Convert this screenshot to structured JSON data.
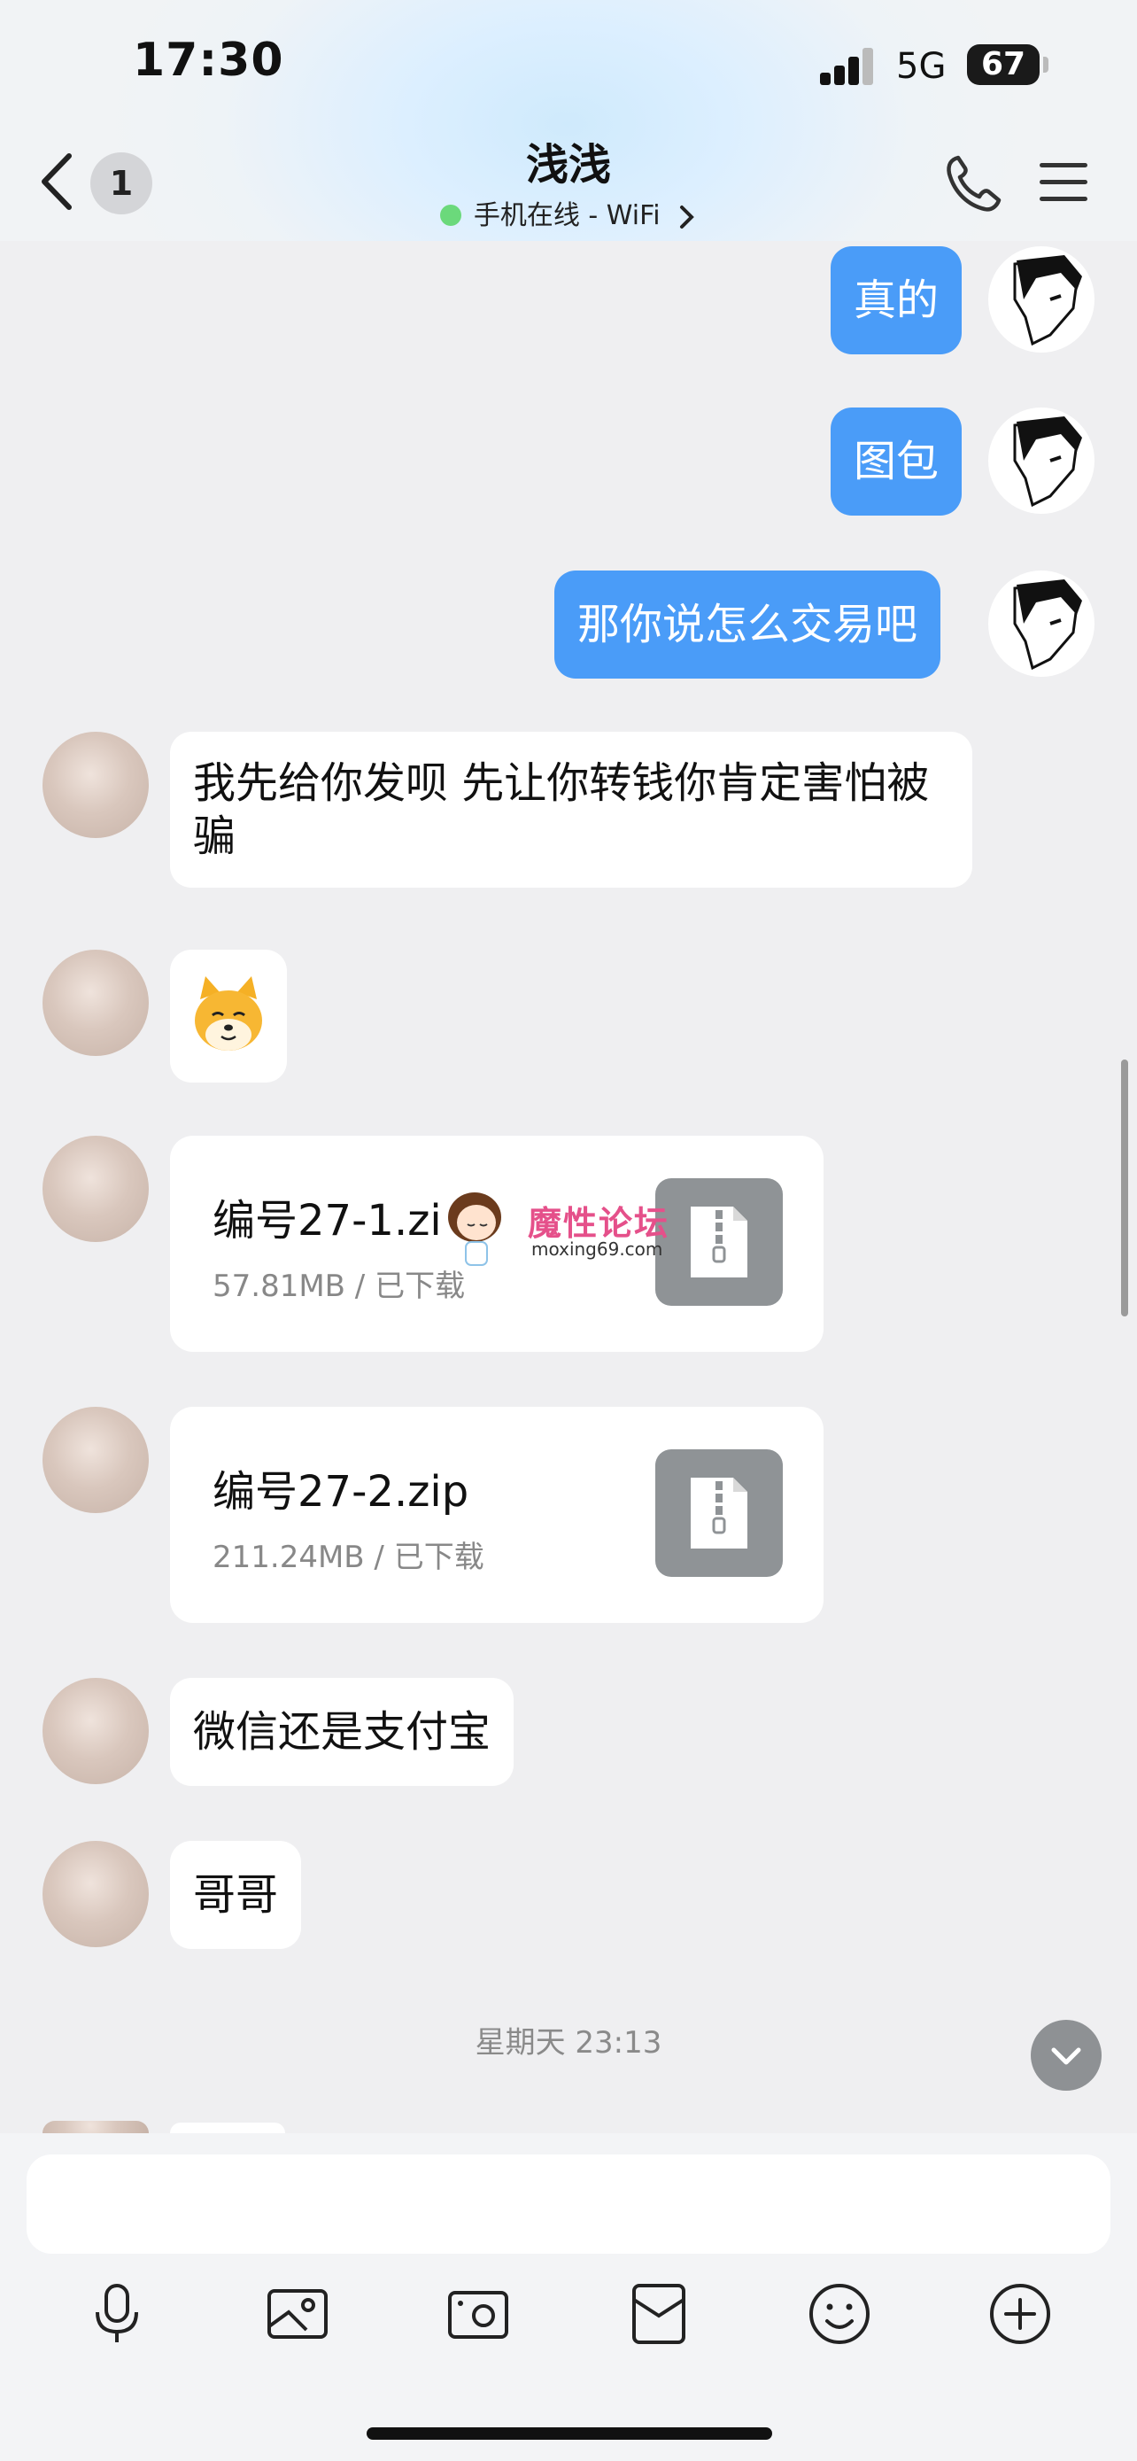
{
  "status_bar": {
    "time": "17:30",
    "network": "5G",
    "battery": "67"
  },
  "header": {
    "unread_count": "1",
    "title": "浅浅",
    "status": "手机在线 - WiFi"
  },
  "messages": {
    "m1": "真的",
    "m2": "图包",
    "m3": "那你说怎么交易吧",
    "m4": "我先给你发呗  先让你转钱你肯定害怕被骗",
    "m7": "微信还是支付宝",
    "m8": "哥哥"
  },
  "files": [
    {
      "name": "编号27-1.zi",
      "meta": "57.81MB / 已下载"
    },
    {
      "name": "编号27-2.zip",
      "meta": "211.24MB / 已下载"
    }
  ],
  "watermark": {
    "text": "魔性论坛",
    "url": "moxing69.com"
  },
  "date_separator": "星期天 23:13",
  "input": {
    "value": ""
  },
  "toolbar_icons": [
    "microphone-icon",
    "image-icon",
    "camera-icon",
    "red-packet-icon",
    "emoji-icon",
    "plus-icon"
  ],
  "colors": {
    "bubble_out": "#4a9cf8",
    "online_dot": "#6bd97b",
    "background": "#efeff1"
  }
}
